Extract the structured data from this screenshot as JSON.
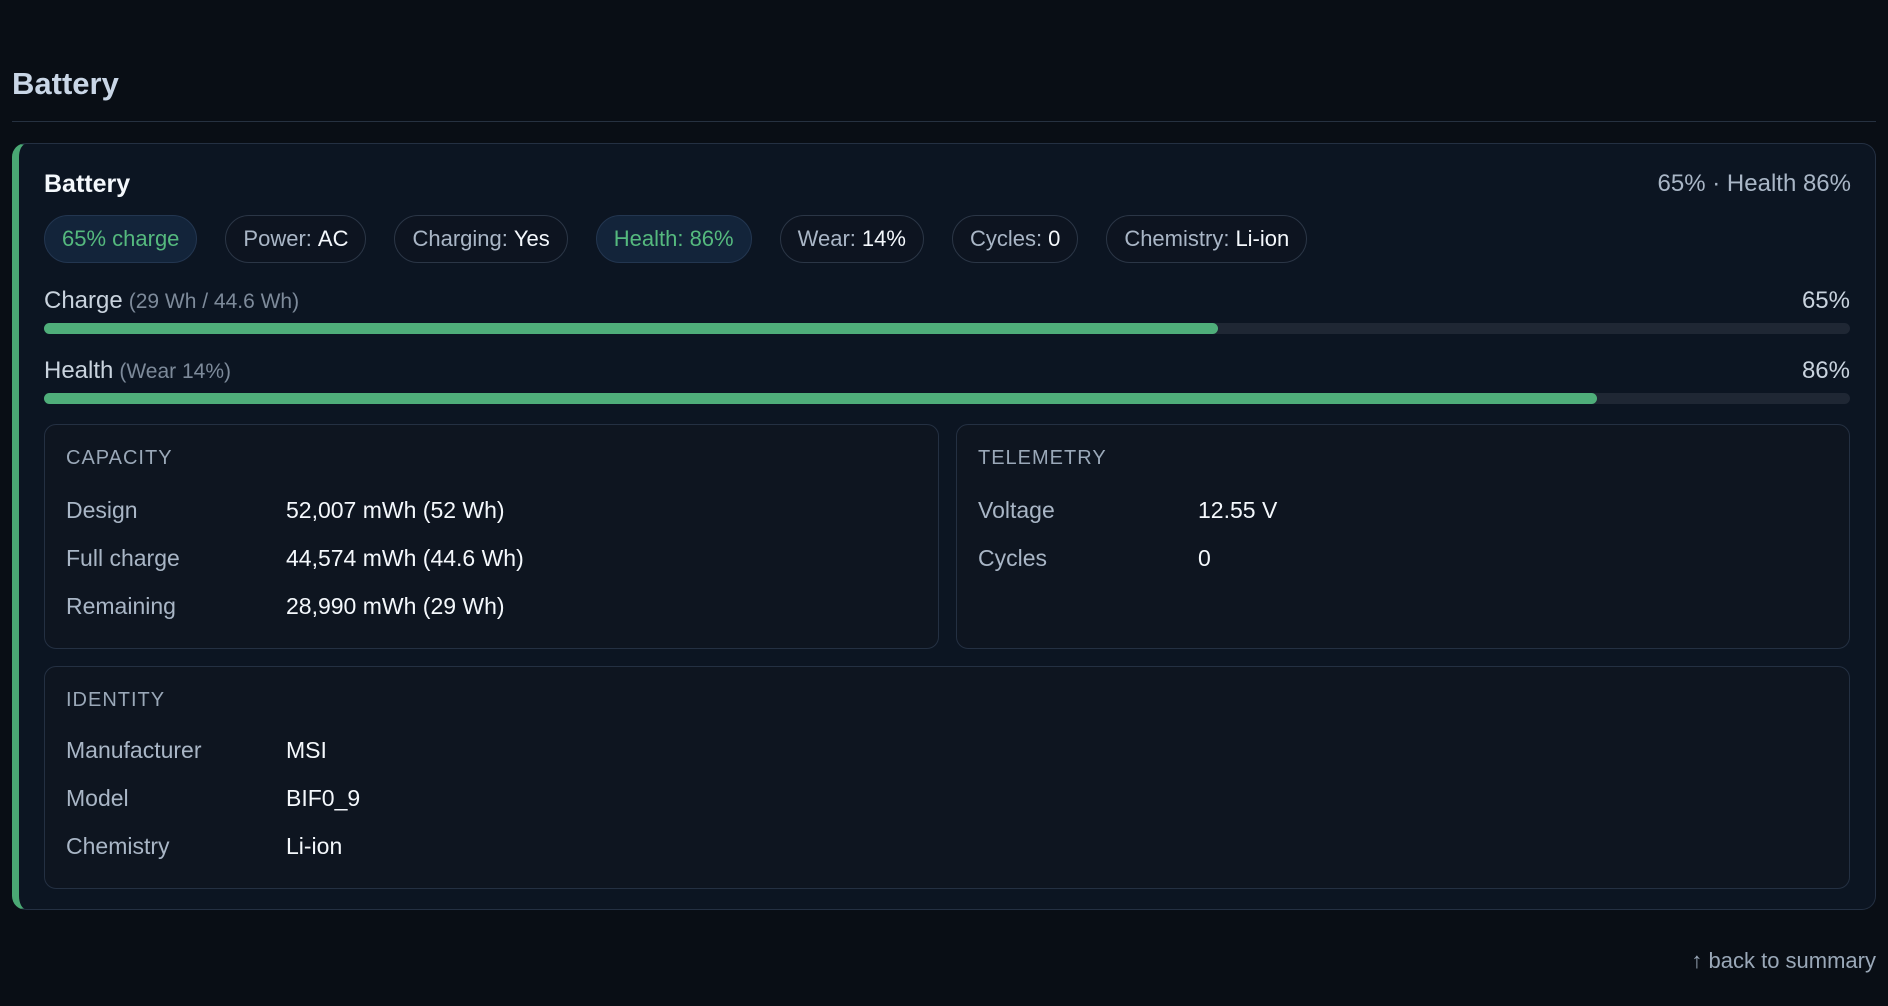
{
  "section": {
    "title": "Battery"
  },
  "card": {
    "title": "Battery",
    "summary": "65% · Health 86%",
    "accent_color": "#4aa874"
  },
  "chips": [
    {
      "label": "65% charge",
      "value": "",
      "accent": true
    },
    {
      "label": "Power:",
      "value": "AC",
      "accent": false
    },
    {
      "label": "Charging:",
      "value": "Yes",
      "accent": false
    },
    {
      "label": "Health: 86%",
      "value": "",
      "accent": true
    },
    {
      "label": "Wear:",
      "value": "14%",
      "accent": false
    },
    {
      "label": "Cycles:",
      "value": "0",
      "accent": false
    },
    {
      "label": "Chemistry:",
      "value": "Li-ion",
      "accent": false
    }
  ],
  "meters": {
    "charge": {
      "label": "Charge",
      "sub": "(29 Wh / 44.6 Wh)",
      "pct_text": "65%",
      "fraction": 0.65
    },
    "health": {
      "label": "Health",
      "sub": "(Wear 14%)",
      "pct_text": "86%",
      "fraction": 0.86
    }
  },
  "capacity": {
    "title": "CAPACITY",
    "rows": [
      {
        "key": "Design",
        "value": "52,007 mWh (52 Wh)"
      },
      {
        "key": "Full charge",
        "value": "44,574 mWh (44.6 Wh)"
      },
      {
        "key": "Remaining",
        "value": "28,990 mWh (29 Wh)"
      }
    ]
  },
  "telemetry": {
    "title": "TELEMETRY",
    "rows": [
      {
        "key": "Voltage",
        "value": "12.55 V"
      },
      {
        "key": "Cycles",
        "value": "0"
      }
    ]
  },
  "identity": {
    "title": "IDENTITY",
    "rows": [
      {
        "key": "Manufacturer",
        "value": "MSI"
      },
      {
        "key": "Model",
        "value": "BIF0_9"
      },
      {
        "key": "Chemistry",
        "value": "Li-ion"
      }
    ]
  },
  "footer": {
    "back_link": "↑ back to summary"
  },
  "colors": {
    "good": "#4fae7a",
    "background": "#090e15",
    "card": "#0c1522"
  }
}
